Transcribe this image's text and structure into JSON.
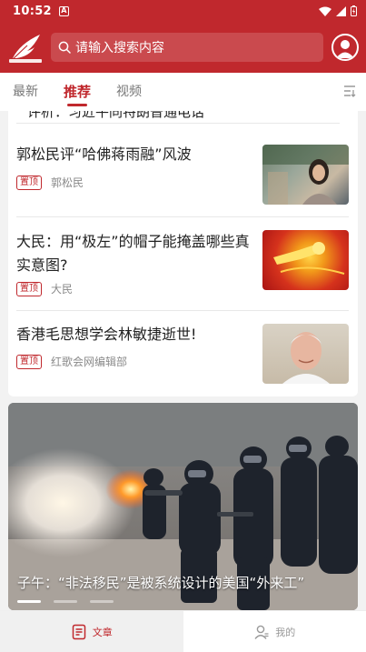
{
  "status": {
    "time": "10:52",
    "notif_letter": "A"
  },
  "header": {
    "search_placeholder": "请输入搜索内容"
  },
  "tabs": [
    {
      "label": "最新"
    },
    {
      "label": "推荐"
    },
    {
      "label": "视频"
    }
  ],
  "feed": {
    "cut_item_title": "评析：习近平同特朗普通电话",
    "articles": [
      {
        "title": "郭松民评“哈佛蒋雨融”风波",
        "badge": "置顶",
        "author": "郭松民"
      },
      {
        "title": "大民：用“极左”的帽子能掩盖哪些真实意图?",
        "badge": "置顶",
        "author": "大民"
      },
      {
        "title": "香港毛思想学会林敏捷逝世!",
        "badge": "置顶",
        "author": "红歌会网编辑部"
      }
    ]
  },
  "banner": {
    "caption": "子午：“非法移民”是被系统设计的美国“外来工”",
    "slide_count": 3,
    "active_slide": 1
  },
  "bottom_nav": {
    "articles": "文章",
    "mine": "我的"
  },
  "colors": {
    "brand_red": "#c0282d"
  }
}
